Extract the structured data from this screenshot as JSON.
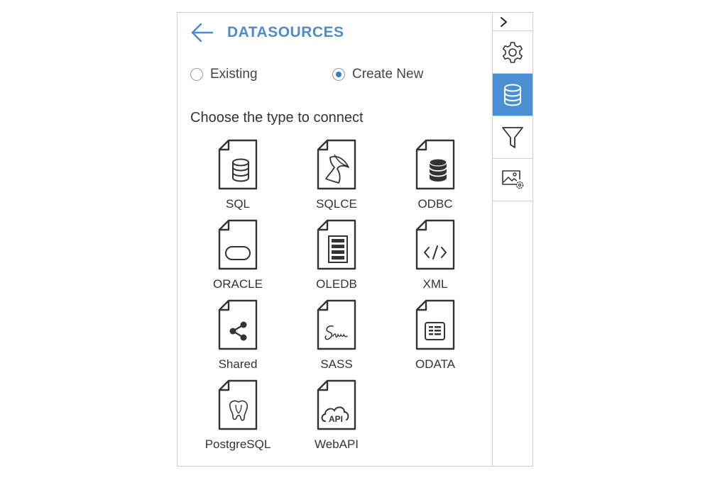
{
  "header": {
    "title": "DATASOURCES",
    "back_icon": "arrow-left-icon"
  },
  "mode": {
    "options": [
      {
        "label": "Existing",
        "checked": false
      },
      {
        "label": "Create New",
        "checked": true
      }
    ]
  },
  "section_title": "Choose the type to connect",
  "datasources": [
    {
      "label": "SQL",
      "icon": "sql-database-file-icon"
    },
    {
      "label": "SQLCE",
      "icon": "sqlce-file-icon"
    },
    {
      "label": "ODBC",
      "icon": "odbc-database-file-icon"
    },
    {
      "label": "ORACLE",
      "icon": "oracle-file-icon"
    },
    {
      "label": "OLEDB",
      "icon": "oledb-file-icon"
    },
    {
      "label": "XML",
      "icon": "xml-file-icon"
    },
    {
      "label": "Shared",
      "icon": "shared-file-icon"
    },
    {
      "label": "SASS",
      "icon": "sass-file-icon"
    },
    {
      "label": "ODATA",
      "icon": "odata-file-icon"
    },
    {
      "label": "PostgreSQL",
      "icon": "postgresql-file-icon"
    },
    {
      "label": "WebAPI",
      "icon": "webapi-file-icon"
    }
  ],
  "rail": {
    "toggle_icon": "chevron-right-icon",
    "buttons": [
      {
        "icon": "gear-icon",
        "active": false
      },
      {
        "icon": "database-icon",
        "active": true
      },
      {
        "icon": "filter-icon",
        "active": false
      },
      {
        "icon": "image-settings-icon",
        "active": false
      }
    ]
  },
  "colors": {
    "accent": "#4f8dc9",
    "active_rail": "#4a8fd4",
    "radio_checked": "#2f7ec8"
  }
}
